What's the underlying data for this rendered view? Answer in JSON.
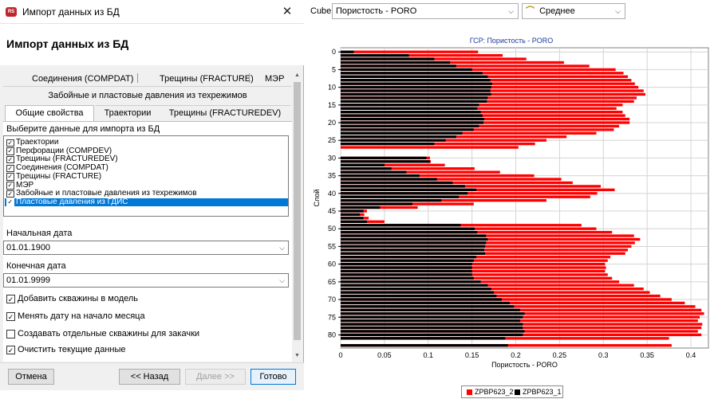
{
  "dialog": {
    "title": "Импорт данных из БД",
    "heading": "Импорт данных  из БД",
    "tabs_row1": [
      "Соединения (COMPDAT)",
      "Трещины (FRACTURE)",
      "МЭР"
    ],
    "tabs_row2": "Забойные и пластовые давления из техрежимов",
    "tabs_row3": [
      "Общие свойства",
      "Траектории",
      "Трещины (FRACTUREDEV)"
    ],
    "select_label": "Выберите данные для импорта из БД",
    "list_items": [
      {
        "label": "Траектории",
        "checked": true
      },
      {
        "label": "Перфорации (COMPDEV)",
        "checked": true
      },
      {
        "label": "Трещины (FRACTUREDEV)",
        "checked": true
      },
      {
        "label": "Соединения (COMPDAT)",
        "checked": true
      },
      {
        "label": "Трещины (FRACTURE)",
        "checked": true
      },
      {
        "label": "МЭР",
        "checked": true
      },
      {
        "label": "Забойные и пластовые давления из техрежимов",
        "checked": true
      },
      {
        "label": "Пластовые давления из ГДИС",
        "checked": true,
        "selected": true
      }
    ],
    "start_date_label": "Начальная дата",
    "start_date": "01.01.1900",
    "end_date_label": "Конечная дата",
    "end_date": "01.01.9999",
    "options": [
      {
        "label": "Добавить скважины в модель",
        "checked": true
      },
      {
        "label": "Менять дату на начало месяца",
        "checked": true
      },
      {
        "label": "Создавать отдельные скважины для закачки",
        "checked": false
      },
      {
        "label": "Очистить текущие данные",
        "checked": true
      }
    ],
    "buttons": {
      "cancel": "Отмена",
      "back": "<< Назад",
      "next": "Далее >>",
      "done": "Готово"
    }
  },
  "toolbar": {
    "cube_label": "Cube X",
    "cube_value": "Пористость - PORO",
    "agg_value": "Среднее"
  },
  "chart_data": {
    "type": "bar",
    "orientation": "horizontal",
    "title": "ГСР: Пористость - PORO",
    "xlabel": "Пористость - PORO",
    "ylabel": "Слой",
    "xlim": [
      0,
      0.42
    ],
    "ylim": [
      0,
      84
    ],
    "xticks": [
      "0",
      "0.05",
      "0.1",
      "0.15",
      "0.2",
      "0.25",
      "0.3",
      "0.35",
      "0.4"
    ],
    "yticks": [
      "0",
      "5",
      "10",
      "15",
      "20",
      "25",
      "30",
      "35",
      "40",
      "45",
      "50",
      "55",
      "60",
      "65",
      "70",
      "75",
      "80"
    ],
    "series": [
      {
        "name": "ZPBP623_2",
        "color": "#ff0000",
        "values": [
          0.157,
          0.185,
          0.212,
          0.255,
          0.284,
          0.314,
          0.323,
          0.328,
          0.332,
          0.336,
          0.34,
          0.346,
          0.348,
          0.338,
          0.335,
          0.322,
          0.315,
          0.322,
          0.325,
          0.33,
          0.33,
          0.318,
          0.312,
          0.292,
          0.258,
          0.235,
          0.222,
          0.203,
          0.0,
          0.0,
          0.102,
          0.103,
          0.119,
          0.153,
          0.182,
          0.221,
          0.252,
          0.265,
          0.297,
          0.313,
          0.293,
          0.285,
          0.235,
          0.152,
          0.088,
          0.03,
          0.027,
          0.032,
          0.05,
          0.275,
          0.292,
          0.31,
          0.335,
          0.342,
          0.336,
          0.332,
          0.328,
          0.325,
          0.308,
          0.305,
          0.302,
          0.303,
          0.302,
          0.305,
          0.31,
          0.318,
          0.335,
          0.346,
          0.353,
          0.365,
          0.378,
          0.393,
          0.405,
          0.412,
          0.415,
          0.41,
          0.408,
          0.413,
          0.412,
          0.408,
          0.412,
          0.375,
          0.0,
          0.378
        ]
      },
      {
        "name": "ZPBP623_1",
        "color": "#000000",
        "values": [
          0.015,
          0.078,
          0.107,
          0.125,
          0.132,
          0.15,
          0.162,
          0.168,
          0.171,
          0.173,
          0.172,
          0.171,
          0.172,
          0.168,
          0.167,
          0.158,
          0.156,
          0.16,
          0.162,
          0.164,
          0.163,
          0.158,
          0.152,
          0.139,
          0.132,
          0.12,
          0.107,
          0.0,
          0.0,
          0.0,
          0.098,
          0.102,
          0.05,
          0.058,
          0.075,
          0.09,
          0.11,
          0.128,
          0.142,
          0.155,
          0.145,
          0.135,
          0.115,
          0.082,
          0.045,
          0.026,
          0.022,
          0.026,
          0.03,
          0.137,
          0.153,
          0.156,
          0.166,
          0.168,
          0.166,
          0.165,
          0.164,
          0.165,
          0.155,
          0.152,
          0.15,
          0.15,
          0.15,
          0.15,
          0.152,
          0.16,
          0.168,
          0.172,
          0.175,
          0.178,
          0.184,
          0.193,
          0.198,
          0.205,
          0.21,
          0.208,
          0.205,
          0.208,
          0.208,
          0.21,
          0.208,
          0.188,
          0.0,
          0.191
        ]
      }
    ],
    "legend": [
      "ZPBP623_2",
      "ZPBP623_1"
    ],
    "legend_position": "bottom",
    "grid": true
  }
}
